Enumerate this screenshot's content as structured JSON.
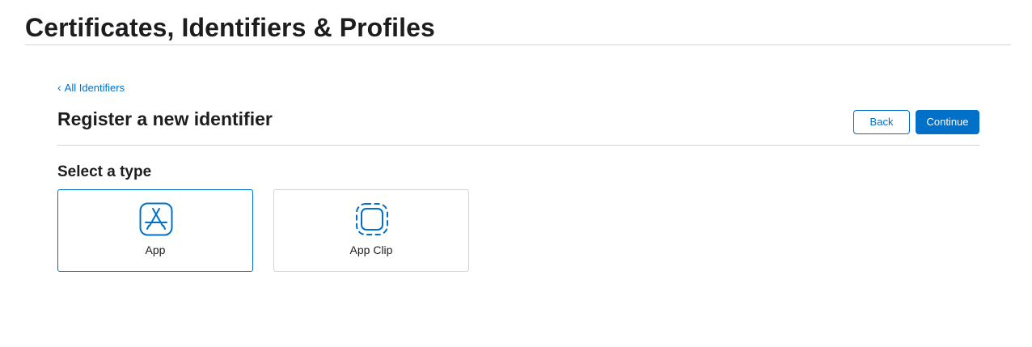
{
  "header": {
    "title": "Certificates, Identifiers & Profiles"
  },
  "nav": {
    "back_link": "All Identifiers",
    "back_icon": "chevron-left-icon"
  },
  "main": {
    "title": "Register a new identifier",
    "back_button": "Back",
    "continue_button": "Continue",
    "select_type_heading": "Select a type",
    "types": [
      {
        "label": "App",
        "icon": "app-store-icon",
        "selected": true
      },
      {
        "label": "App Clip",
        "icon": "app-clip-icon",
        "selected": false
      }
    ]
  },
  "colors": {
    "accent": "#0070c9",
    "text": "#1d1d1f",
    "border": "#d2d2d7"
  }
}
